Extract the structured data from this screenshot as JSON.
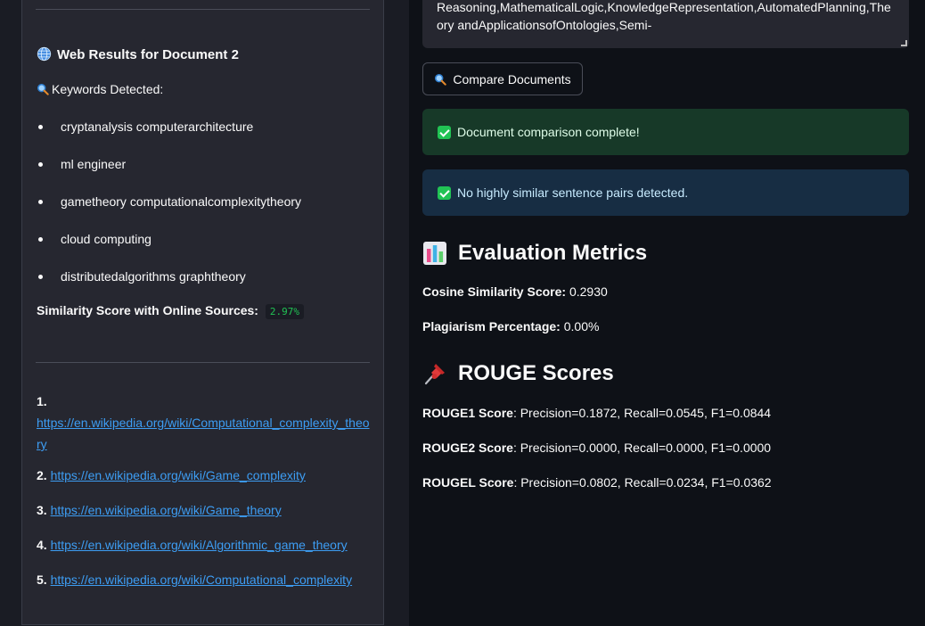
{
  "sidebar": {
    "web_results_title": "Web Results for Document 2",
    "keywords_title": "Keywords Detected:",
    "keywords": [
      "cryptanalysis computerarchitecture",
      "ml engineer",
      "gametheory computationalcomplexitytheory",
      "cloud computing",
      "distributedalgorithms graphtheory"
    ],
    "similarity_label": "Similarity Score with Online Sources:",
    "similarity_value": "2.97%",
    "links": [
      {
        "num": "1.",
        "url": "https://en.wikipedia.org/wiki/Computational_complexity_theory"
      },
      {
        "num": "2.",
        "url": "https://en.wikipedia.org/wiki/Game_complexity"
      },
      {
        "num": "3.",
        "url": "https://en.wikipedia.org/wiki/Game_theory"
      },
      {
        "num": "4.",
        "url": "https://en.wikipedia.org/wiki/Algorithmic_game_theory"
      },
      {
        "num": "5.",
        "url": "https://en.wikipedia.org/wiki/Computational_complexity"
      }
    ]
  },
  "main": {
    "textarea_text": "Reasoning,MathematicalLogic,KnowledgeRepresentation,AutomatedPlanning,Theory andApplicationsofOntologies,Semi-",
    "compare_button": "Compare Documents",
    "success_message": "Document comparison complete!",
    "info_message": "No highly similar sentence pairs detected.",
    "metrics_heading": "Evaluation Metrics",
    "cosine_label": "Cosine Similarity Score:",
    "cosine_value": "0.2930",
    "plagiarism_label": "Plagiarism Percentage:",
    "plagiarism_value": "0.00%",
    "rouge_heading": "ROUGE Scores",
    "rouge": [
      {
        "label": "ROUGE1 Score",
        "value": ": Precision=0.1872, Recall=0.0545, F1=0.0844"
      },
      {
        "label": "ROUGE2 Score",
        "value": ": Precision=0.0000, Recall=0.0000, F1=0.0000"
      },
      {
        "label": "ROUGEL Score",
        "value": ": Precision=0.0802, Recall=0.0234, F1=0.0362"
      }
    ]
  },
  "icons": {
    "globe": "globe-icon",
    "magnifier": "magnifying-glass-icon",
    "check": "check-box-icon",
    "chart": "bar-chart-icon",
    "pin": "pushpin-icon"
  },
  "colors": {
    "background": "#0e1117",
    "panel": "#262730",
    "link": "#3d9df3",
    "success_bg": "#173928",
    "info_bg": "#172d43",
    "code_green": "#21c354"
  }
}
